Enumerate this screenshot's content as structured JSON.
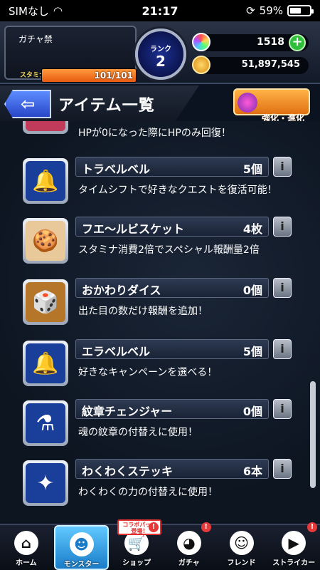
{
  "status_bar": {
    "carrier": "SIMなし",
    "time": "21:17",
    "battery": "59%"
  },
  "header": {
    "gacha_label": "ガチャ禁",
    "stamina_label": "スタミナ",
    "stamina": "101/101",
    "stamina_fraction": 1.0,
    "rank_label": "ランク",
    "rank": "2",
    "orbs": "1518",
    "coins": "51,897,545"
  },
  "title_bar": {
    "title": "アイテム一覧",
    "evo_button": "強化・進化\n素材"
  },
  "items": [
    {
      "name": "",
      "count": "",
      "desc": "HPが0になった際にHPのみ回復！",
      "icon": "heart-icon"
    },
    {
      "name": "トラベルベル",
      "count": "5個",
      "desc": "タイムシフトで好きなクエストを復活可能！",
      "icon": "bell-icon"
    },
    {
      "name": "フエ〜ルビスケット",
      "count": "4枚",
      "desc": "スタミナ消費2倍でスペシャル報酬量2倍",
      "icon": "biscuit-icon"
    },
    {
      "name": "おかわりダイス",
      "count": "0個",
      "desc": "出た目の数だけ報酬を追加！",
      "icon": "dice-icon"
    },
    {
      "name": "エラベルベル",
      "count": "5個",
      "desc": "好きなキャンペーンを選べる！",
      "icon": "golden-bell-icon"
    },
    {
      "name": "紋章チェンジャー",
      "count": "0個",
      "desc": "魂の紋章の付替えに使用！",
      "icon": "potion-icon"
    },
    {
      "name": "わくわくステッキ",
      "count": "6本",
      "desc": "わくわくの力の付替えに使用！",
      "icon": "wand-icon"
    }
  ],
  "nav": [
    {
      "label": "ホーム",
      "icon": "home-icon",
      "glyph": "⌂"
    },
    {
      "label": "モンスター",
      "icon": "monster-icon",
      "glyph": "☻"
    },
    {
      "label": "ショップ",
      "icon": "shop-cart-icon",
      "glyph": "🛒"
    },
    {
      "label": "ガチャ",
      "icon": "gacha-icon",
      "glyph": "◕"
    },
    {
      "label": "フレンド",
      "icon": "friend-icon",
      "glyph": "☺"
    },
    {
      "label": "ストライカー",
      "icon": "striker-icon",
      "glyph": "▶"
    }
  ],
  "collab_badge": "コラボパック\n登場！",
  "alert_mark": "!"
}
